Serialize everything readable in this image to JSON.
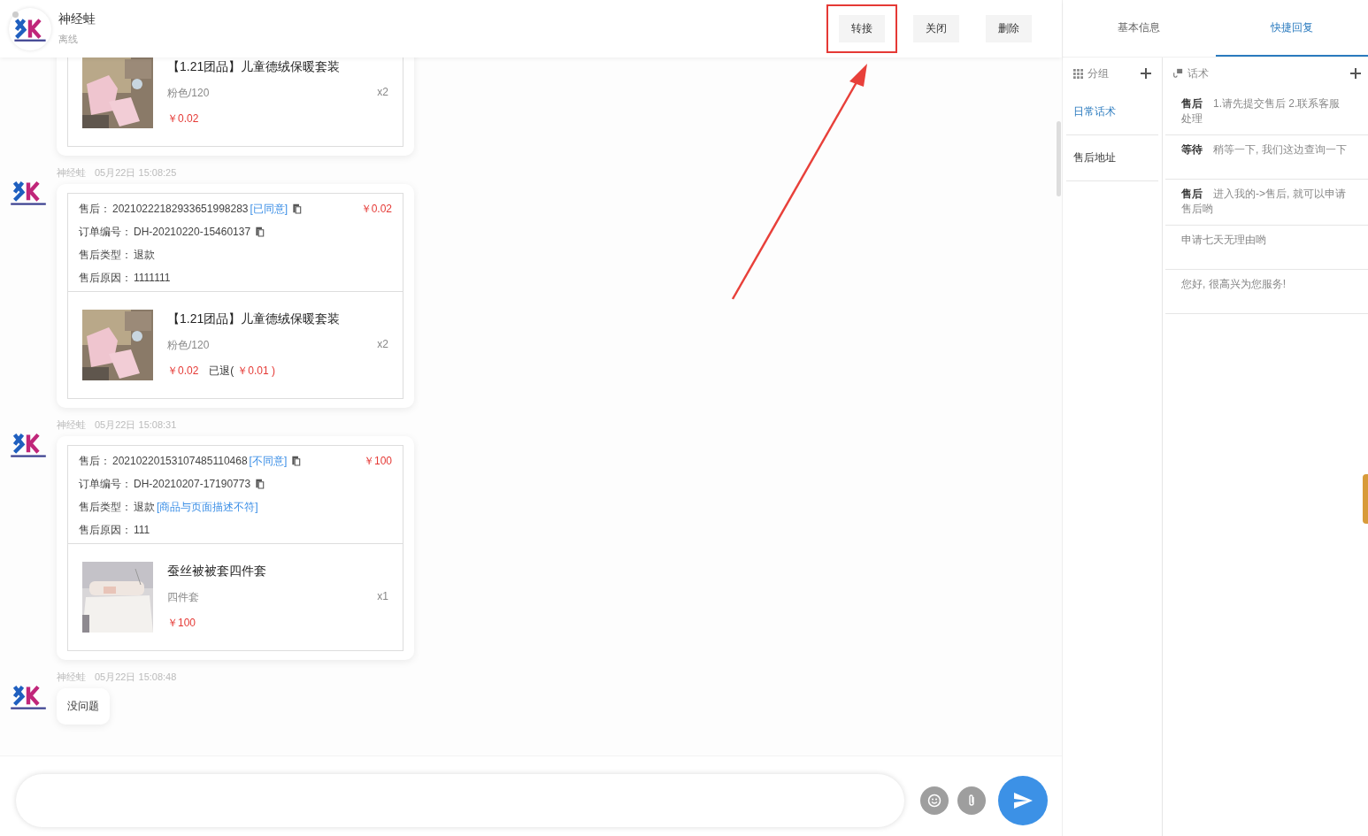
{
  "header": {
    "name": "神经蛙",
    "status": "离线",
    "buttons": [
      {
        "label": "转接",
        "highlighted": true
      },
      {
        "label": "关闭",
        "highlighted": false
      },
      {
        "label": "删除",
        "highlighted": false
      }
    ]
  },
  "messages": [
    {
      "product": {
        "title": "【1.21团品】儿童德绒保暖套装",
        "spec": "粉色/120",
        "qty": "x2",
        "price": "￥0.02"
      }
    },
    {
      "sender": "神经蛙",
      "time": "05月22日 15:08:25",
      "aftersale": {
        "label": "售后：",
        "id": "20210222182933651998283",
        "status": "[已同意]",
        "amount": "￥0.02",
        "order_label": "订单编号：",
        "order": "DH-20210220-15460137",
        "type_label": "售后类型：",
        "type": "退款",
        "reason_label": "售后原因：",
        "reason": "1111111"
      },
      "product": {
        "title": "【1.21团品】儿童德绒保暖套装",
        "spec": "粉色/120",
        "qty": "x2",
        "price": "￥0.02",
        "refund_label": "已退(",
        "refund": "￥0.01 )"
      }
    },
    {
      "sender": "神经蛙",
      "time": "05月22日 15:08:31",
      "aftersale": {
        "label": "售后：",
        "id": "20210220153107485110468",
        "status": "[不同意]",
        "amount": "￥100",
        "order_label": "订单编号：",
        "order": "DH-20210207-17190773",
        "type_label": "售后类型：",
        "type": "退款",
        "type_note": "[商品与页面描述不符]",
        "reason_label": "售后原因：",
        "reason": "111"
      },
      "product": {
        "title": "蚕丝被被套四件套",
        "spec": "四件套",
        "qty": "x1",
        "price": "￥100"
      }
    },
    {
      "sender": "神经蛙",
      "time": "05月22日 15:08:48",
      "text": "没问题"
    }
  ],
  "tabs": [
    {
      "label": "基本信息",
      "selected": false
    },
    {
      "label": "快捷回复",
      "selected": true
    }
  ],
  "groups": {
    "title": "分组",
    "items": [
      {
        "label": "日常话术",
        "selected": true
      },
      {
        "label": "售后地址",
        "selected": false
      }
    ]
  },
  "replies": {
    "title": "话术",
    "items": [
      {
        "tag": "售后",
        "text": "1.请先提交售后 2.联系客服处理"
      },
      {
        "tag": "等待",
        "text": "稍等一下, 我们这边查询一下"
      },
      {
        "tag": "售后",
        "text": "进入我的->售后, 就可以申请售后哟"
      },
      {
        "text": "申请七天无理由哟"
      },
      {
        "text": "您好, 很高兴为您服务!"
      }
    ]
  }
}
